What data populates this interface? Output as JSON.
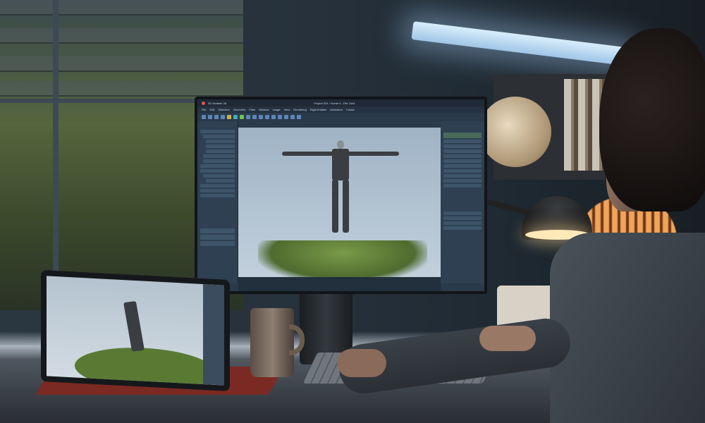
{
  "monitor_app": {
    "app_name": "3D Modeler 28",
    "document_title": "Project 324 / Scene 6 - File 2444",
    "menu": [
      "File",
      "Edit",
      "Selection",
      "Geometry",
      "Filter",
      "Window",
      "Image",
      "View",
      "Rendering",
      "Rigid Entities",
      "Animation",
      "Create"
    ],
    "viewport_bg": "#b4c4d2",
    "accent": "#5d86b8"
  }
}
